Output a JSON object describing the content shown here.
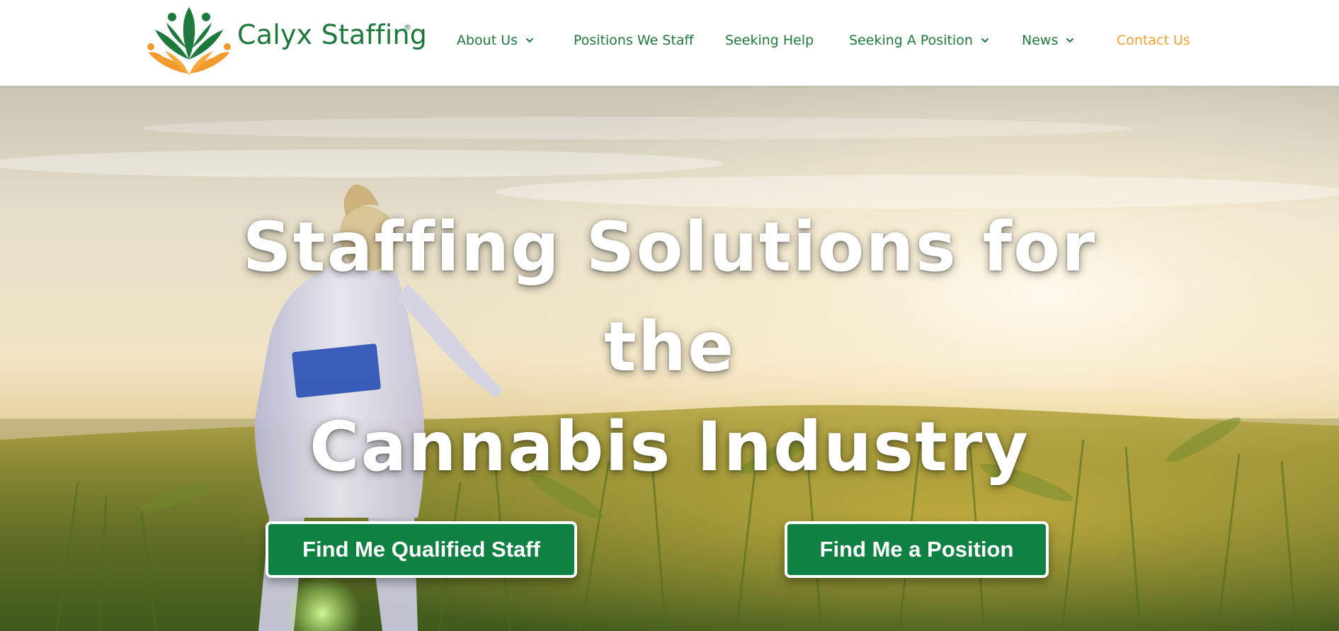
{
  "brand": {
    "name": "Calyx Staffing",
    "registered_mark": "®",
    "colors": {
      "primary_green": "#1e7a3c",
      "button_green": "#0f8142",
      "accent_orange": "#f0a030"
    }
  },
  "nav": {
    "items": [
      {
        "label": "About Us",
        "has_dropdown": true
      },
      {
        "label": "Positions We Staff",
        "has_dropdown": false
      },
      {
        "label": "Seeking Help",
        "has_dropdown": false
      },
      {
        "label": "Seeking A Position",
        "has_dropdown": true
      },
      {
        "label": "News",
        "has_dropdown": true
      },
      {
        "label": "Contact Us",
        "has_dropdown": false,
        "highlight_color": "#f0a030"
      }
    ]
  },
  "hero": {
    "title_line1": "Staffing Solutions for the",
    "title_line2": "Cannabis Industry",
    "buttons": {
      "staff": "Find Me Qualified Staff",
      "position": "Find Me a Position"
    }
  },
  "icons": [
    "calyx-logo-icon",
    "chevron-down-icon"
  ]
}
